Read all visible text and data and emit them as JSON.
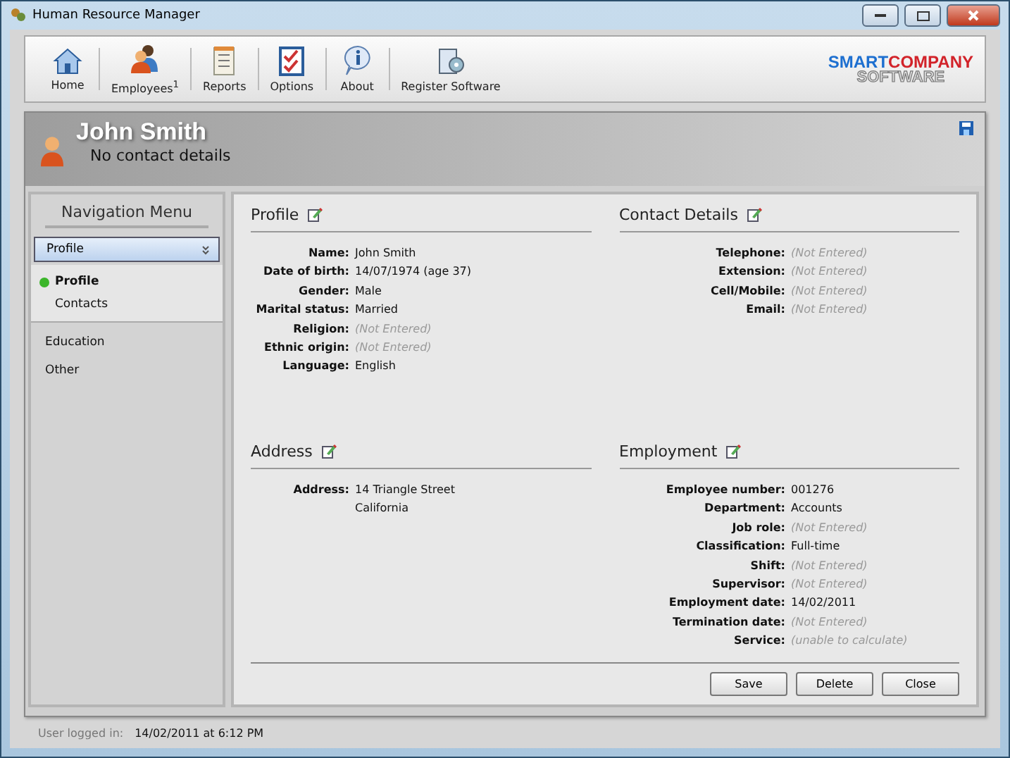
{
  "window": {
    "title": "Human Resource Manager"
  },
  "toolbar": [
    {
      "label": "Home"
    },
    {
      "label": "Employees$^{1}$"
    },
    {
      "label": "Reports"
    },
    {
      "label": "Options"
    },
    {
      "label": "About"
    },
    {
      "label": "Register Software"
    }
  ],
  "logo": {
    "line_1a": "SMART",
    "line_1b": "COMPANY",
    "line_2": "SOFTWARE"
  },
  "header": {
    "name": "John Smith",
    "subtitle": "No contact details"
  },
  "nav": {
    "title": "Navigation Menu",
    "group": {
      "label": "Profile",
      "expanded": true,
      "children": [
        {
          "label": "Profile",
          "selected": true
        },
        {
          "label": "Contacts",
          "selected": false
        }
      ]
    },
    "items": [
      {
        "label": "Education"
      },
      {
        "label": "Other"
      }
    ]
  },
  "sections": [
    {
      "title": "Profile",
      "fields": [
        {
          "label": "Name:",
          "lines": [
            "John Smith"
          ],
          "entered": true
        },
        {
          "label": "Date of birth:",
          "lines": [
            "14/07/1974 (age 37)"
          ],
          "entered": true
        },
        {
          "label": "Gender:",
          "lines": [
            "Male"
          ],
          "entered": true
        },
        {
          "label": "Marital status:",
          "lines": [
            "Married"
          ],
          "entered": true
        },
        {
          "label": "Religion:",
          "lines": [
            "(Not Entered)"
          ],
          "entered": false
        },
        {
          "label": "Ethnic origin:",
          "lines": [
            "(Not Entered)"
          ],
          "entered": false
        },
        {
          "label": "Language:",
          "lines": [
            "English"
          ],
          "entered": true
        }
      ]
    },
    {
      "title": "Contact Details",
      "fields": [
        {
          "label": "Telephone:",
          "lines": [
            "(Not Entered)"
          ],
          "entered": false
        },
        {
          "label": "Extension:",
          "lines": [
            "(Not Entered)"
          ],
          "entered": false
        },
        {
          "label": "Cell/Mobile:",
          "lines": [
            "(Not Entered)"
          ],
          "entered": false
        },
        {
          "label": "Email:",
          "lines": [
            "(Not Entered)"
          ],
          "entered": false
        }
      ]
    },
    {
      "title": "Address",
      "fields": [
        {
          "label": "Address:",
          "lines": [
            "14 Triangle Street",
            "California"
          ],
          "entered": true
        }
      ]
    },
    {
      "title": "Employment",
      "fields": [
        {
          "label": "Employee number:",
          "lines": [
            "001276"
          ],
          "entered": true
        },
        {
          "label": "Department:",
          "lines": [
            "Accounts"
          ],
          "entered": true
        },
        {
          "label": "Job role:",
          "lines": [
            "(Not Entered)"
          ],
          "entered": false
        },
        {
          "label": "Classification:",
          "lines": [
            "Full-time"
          ],
          "entered": true
        },
        {
          "label": "Shift:",
          "lines": [
            "(Not Entered)"
          ],
          "entered": false
        },
        {
          "label": "Supervisor:",
          "lines": [
            "(Not Entered)"
          ],
          "entered": false
        },
        {
          "label": "Employment date:",
          "lines": [
            "14/02/2011"
          ],
          "entered": true
        },
        {
          "label": "Termination date:",
          "lines": [
            "(Not Entered)"
          ],
          "entered": false
        },
        {
          "label": "Service:",
          "lines": [
            "(unable to calculate)"
          ],
          "entered": false
        }
      ]
    }
  ],
  "buttons": [
    "Save",
    "Delete",
    "Close"
  ],
  "status_bar": {
    "label": "User logged in:",
    "value": "14/02/2011 at 6:12 PM"
  }
}
